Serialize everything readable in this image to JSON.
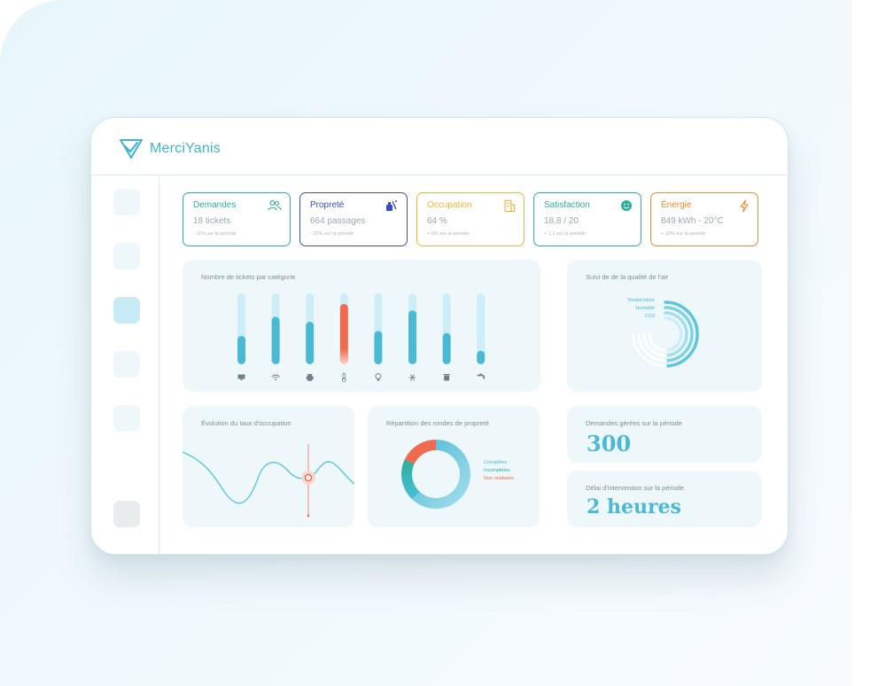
{
  "app": {
    "name": "MerciYanis"
  },
  "kpis": [
    {
      "title": "Demandes",
      "value": "18 tickets",
      "sub": "- 11% sur la période",
      "color": "#2fae99",
      "icon": "users-icon"
    },
    {
      "title": "Propreté",
      "value": "664 passages",
      "sub": "- 22% sur la période",
      "color": "#3b4cc4",
      "icon": "cleaning-icon"
    },
    {
      "title": "Occupation",
      "value": "64 %",
      "sub": "+ 6% sur la période",
      "color": "#f2b33a",
      "icon": "building-icon"
    },
    {
      "title": "Satisfaction",
      "value": "18,8 / 20",
      "sub": "+ 1,1 sur la période",
      "color": "#2fae99",
      "icon": "smiley-icon"
    },
    {
      "title": "Énergie",
      "value": "849 kWh - 20°C",
      "sub": "+ 13% sur la période",
      "color": "#ef8a2e",
      "icon": "lightning-icon"
    }
  ],
  "tickets_card": {
    "title": "Nombre de tickets par catégorie"
  },
  "air_card": {
    "title": "Suivi de de la qualité de l'air",
    "legend": [
      "Température",
      "Humidité",
      "CO2"
    ]
  },
  "occupation_card": {
    "title": "Évolution du taux d'occupation"
  },
  "rondes_card": {
    "title": "Répartition des rondes de propreté",
    "legend": [
      "Complètes",
      "Incomplètes",
      "Non réalisées"
    ]
  },
  "demandes_card": {
    "title": "Demandes gérées sur la période",
    "value": "300"
  },
  "delai_card": {
    "title": "Délai d'intervention sur la période",
    "value": "2 heures"
  },
  "colors": {
    "accent": "#4ab9d4",
    "accent_light": "#cdeef7",
    "alert": "#f06a4f"
  },
  "chart_data": [
    {
      "type": "bar",
      "categories": [
        "monitor-icon",
        "wifi-icon",
        "printer-icon",
        "thermometer-icon",
        "bulb-icon",
        "snowflake-icon",
        "trash-icon",
        "faucet-icon"
      ],
      "values": [
        40,
        67,
        60,
        85,
        47,
        76,
        44,
        19
      ],
      "ylim": [
        0,
        100
      ],
      "highlight_index": 3
    },
    {
      "type": "pie",
      "categories": [
        "Complètes",
        "Incomplètes",
        "Non réalisées"
      ],
      "values": [
        62,
        20,
        18
      ]
    }
  ]
}
